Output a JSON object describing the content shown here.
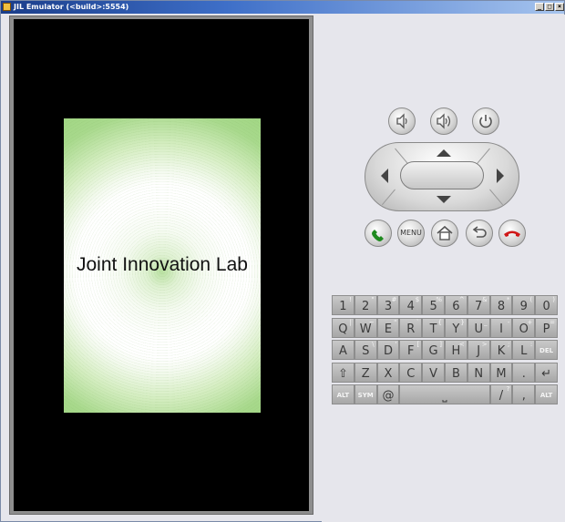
{
  "window": {
    "title": "JIL Emulator (<build>:5554)",
    "min_label": "_",
    "max_label": "□",
    "close_label": "×"
  },
  "screen": {
    "splash_text": "Joint Innovation Lab"
  },
  "controls": {
    "volume_down": "volume-down-icon",
    "volume_up": "volume-up-icon",
    "power": "power-icon",
    "call": "call-icon",
    "menu_label": "MENU",
    "home": "home-icon",
    "back": "back-icon",
    "end_call": "end-call-icon"
  },
  "keyboard": {
    "row1": [
      {
        "main": "1",
        "alt": "!"
      },
      {
        "main": "2",
        "alt": "\""
      },
      {
        "main": "3",
        "alt": "#"
      },
      {
        "main": "4",
        "alt": "$"
      },
      {
        "main": "5",
        "alt": "%"
      },
      {
        "main": "6",
        "alt": "^"
      },
      {
        "main": "7",
        "alt": "&"
      },
      {
        "main": "8",
        "alt": "*"
      },
      {
        "main": "9",
        "alt": "("
      },
      {
        "main": "0",
        "alt": ")"
      }
    ],
    "row2": [
      {
        "main": "Q",
        "alt": "|"
      },
      {
        "main": "W",
        "alt": "~"
      },
      {
        "main": "E",
        "alt": "\""
      },
      {
        "main": "R",
        "alt": "`"
      },
      {
        "main": "T",
        "alt": "{"
      },
      {
        "main": "Y",
        "alt": "}"
      },
      {
        "main": "U",
        "alt": "_"
      },
      {
        "main": "I",
        "alt": "-"
      },
      {
        "main": "O",
        "alt": "+"
      },
      {
        "main": "P",
        "alt": "="
      }
    ],
    "row3": [
      {
        "main": "A",
        "alt": ""
      },
      {
        "main": "S",
        "alt": "\\"
      },
      {
        "main": "D",
        "alt": "'"
      },
      {
        "main": "F",
        "alt": "["
      },
      {
        "main": "G",
        "alt": "]"
      },
      {
        "main": "H",
        "alt": "<"
      },
      {
        "main": "J",
        "alt": ">"
      },
      {
        "main": "K",
        "alt": ";"
      },
      {
        "main": "L",
        "alt": ":"
      },
      {
        "main": "DEL",
        "alt": ""
      }
    ],
    "row4": [
      {
        "main": "⇧",
        "alt": ""
      },
      {
        "main": "Z",
        "alt": ""
      },
      {
        "main": "X",
        "alt": ""
      },
      {
        "main": "C",
        "alt": ""
      },
      {
        "main": "V",
        "alt": ""
      },
      {
        "main": "B",
        "alt": ""
      },
      {
        "main": "N",
        "alt": ""
      },
      {
        "main": "M",
        "alt": ""
      },
      {
        "main": ".",
        "alt": ""
      },
      {
        "main": "↵",
        "alt": ""
      }
    ],
    "row5": [
      {
        "main": "ALT",
        "alt": ""
      },
      {
        "main": "SYM",
        "alt": ""
      },
      {
        "main": "@",
        "alt": ""
      },
      {
        "main": "⎵",
        "alt": ""
      },
      {
        "main": "/",
        "alt": "?"
      },
      {
        "main": ",",
        "alt": ""
      },
      {
        "main": "ALT",
        "alt": ""
      }
    ]
  }
}
